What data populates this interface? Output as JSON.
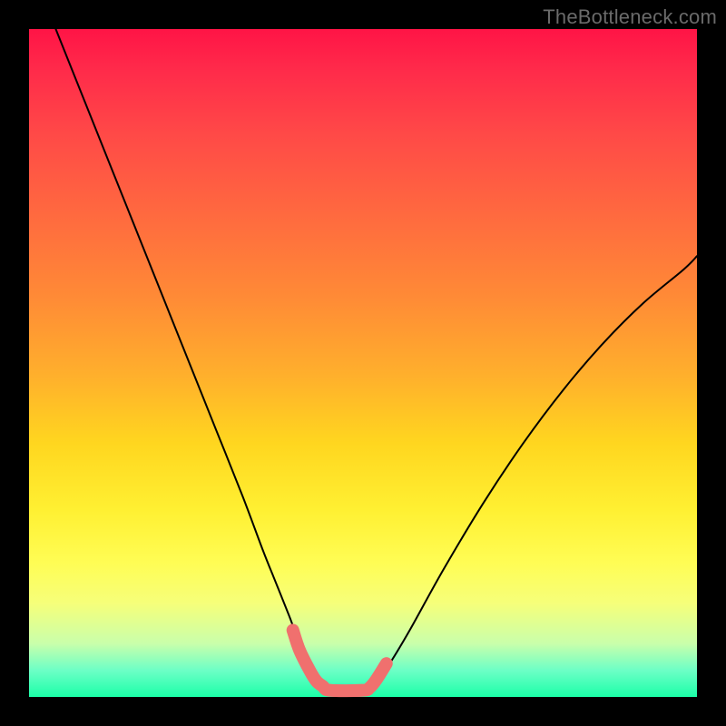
{
  "watermark": "TheBottleneck.com",
  "chart_data": {
    "type": "line",
    "title": "",
    "xlabel": "",
    "ylabel": "",
    "xlim": [
      0,
      100
    ],
    "ylim": [
      0,
      100
    ],
    "grid": false,
    "series": [
      {
        "name": "curve",
        "color": "#000000",
        "x": [
          4,
          8,
          12,
          16,
          20,
          24,
          28,
          32,
          35,
          37,
          39,
          40.5,
          42,
          43,
          44,
          45,
          50,
          51,
          52,
          54,
          57,
          62,
          68,
          74,
          80,
          86,
          92,
          98,
          100
        ],
        "y": [
          100,
          90,
          80,
          70,
          60,
          50,
          40,
          30,
          22,
          17,
          12,
          8,
          5,
          3,
          1.6,
          1,
          1,
          1.4,
          2.2,
          5,
          10,
          19,
          29,
          38,
          46,
          53,
          59,
          64,
          66
        ]
      },
      {
        "name": "bottom-highlight",
        "color": "#f0706e",
        "x": [
          39.5,
          40.5,
          42,
          43,
          44,
          45,
          50,
          51,
          52,
          53.5
        ],
        "y": [
          10,
          7,
          4,
          2.4,
          1.6,
          1,
          1,
          1.4,
          2.6,
          5
        ]
      }
    ],
    "gradient_stops": [
      {
        "pos": 0,
        "color": "#ff1446"
      },
      {
        "pos": 50,
        "color": "#ffb02c"
      },
      {
        "pos": 75,
        "color": "#fff032"
      },
      {
        "pos": 100,
        "color": "#1bffa8"
      }
    ]
  }
}
